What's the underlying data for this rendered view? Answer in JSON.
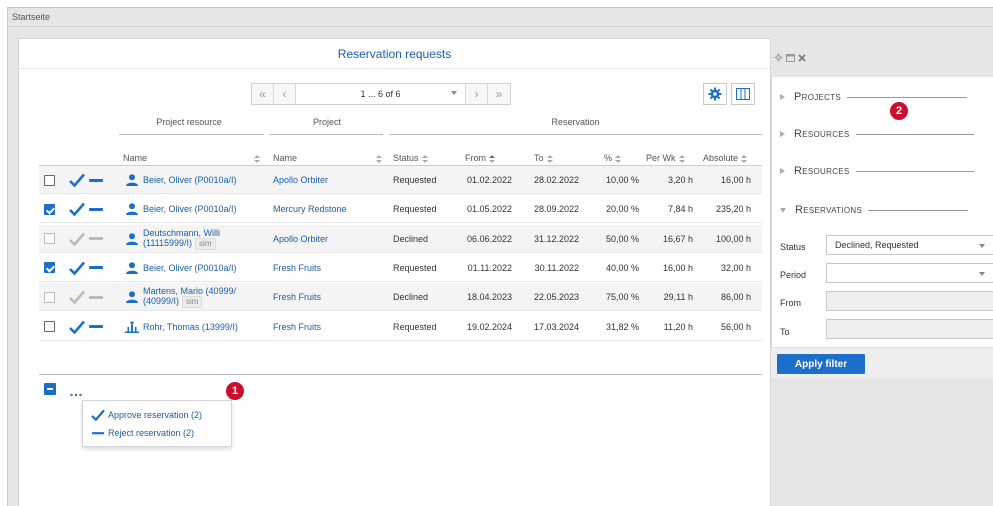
{
  "page": {
    "breadcrumb": "Startseite"
  },
  "main": {
    "title": "Reservation requests",
    "pager": {
      "page_text": "1 ... 6 of 6"
    }
  },
  "table": {
    "group_headers": {
      "resource": "Project resource",
      "project": "Project",
      "reservation": "Reservation"
    },
    "columns": {
      "resource_name": "Name",
      "project_name": "Name",
      "status": "Status",
      "from": "From",
      "to": "To",
      "percent": "%",
      "per_wk": "Per Wk",
      "absolute": "Absolute"
    },
    "rows": [
      {
        "checked": false,
        "disabled": false,
        "resource_l1": "Beier, Oliver (P0010a/I)",
        "resource_l2": "",
        "sim": false,
        "resource_type": "person",
        "project": "Apollo Orbiter",
        "status": "Requested",
        "from": "01.02.2022",
        "to": "28.02.2022",
        "percent": "10,00 %",
        "per_wk": "3,20 h",
        "absolute": "16,00 h"
      },
      {
        "checked": true,
        "disabled": false,
        "resource_l1": "Beier, Oliver (P0010a/I)",
        "resource_l2": "",
        "sim": false,
        "resource_type": "person",
        "project": "Mercury Redstone",
        "status": "Requested",
        "from": "01.05.2022",
        "to": "28.09.2022",
        "percent": "20,00 %",
        "per_wk": "7,84 h",
        "absolute": "235,20 h"
      },
      {
        "checked": false,
        "disabled": true,
        "resource_l1": "Deutschmann, Willi",
        "resource_l2": "(11115999/I)",
        "sim": true,
        "resource_type": "person",
        "project": "Apollo Orbiter",
        "status": "Declined",
        "from": "06.06.2022",
        "to": "31.12.2022",
        "percent": "50,00 %",
        "per_wk": "16,67 h",
        "absolute": "100,00 h"
      },
      {
        "checked": true,
        "disabled": false,
        "resource_l1": "Beier, Oliver (P0010a/I)",
        "resource_l2": "",
        "sim": false,
        "resource_type": "person",
        "project": "Fresh Fruits",
        "status": "Requested",
        "from": "01.11.2022",
        "to": "30.11.2022",
        "percent": "40,00 %",
        "per_wk": "16,00 h",
        "absolute": "32,00 h"
      },
      {
        "checked": false,
        "disabled": true,
        "resource_l1": "Martens, Mario (40999/",
        "resource_l2": "(40999/I)",
        "sim": true,
        "resource_type": "person",
        "project": "Fresh Fruits",
        "status": "Declined",
        "from": "18.04.2023",
        "to": "22.05.2023",
        "percent": "75,00 %",
        "per_wk": "29,11 h",
        "absolute": "86,00 h"
      },
      {
        "checked": false,
        "disabled": false,
        "resource_l1": "Rohr, Thomas (13999/I)",
        "resource_l2": "",
        "sim": false,
        "resource_type": "team",
        "project": "Fresh Fruits",
        "status": "Requested",
        "from": "19.02.2024",
        "to": "17.03.2024",
        "percent": "31,82 %",
        "per_wk": "11,20 h",
        "absolute": "56,00 h"
      }
    ],
    "sim_label": "sim"
  },
  "actions_popup": {
    "approve": "Approve reservation (2)",
    "reject": "Reject reservation (2)"
  },
  "badges": {
    "one": "1",
    "two": "2"
  },
  "filter_panel": {
    "sections": {
      "projects": "Projects",
      "resources_1": "Resources",
      "resources_2": "Resources",
      "reservations": "Reservations"
    },
    "fields": {
      "status_label": "Status",
      "status_value": "Declined, Requested",
      "period_label": "Period",
      "period_value": "",
      "from_label": "From",
      "to_label": "To"
    },
    "apply_label": "Apply filter"
  },
  "colors": {
    "accent": "#1c6fc9",
    "link": "#1a5ea8",
    "badge": "#c8102e"
  }
}
